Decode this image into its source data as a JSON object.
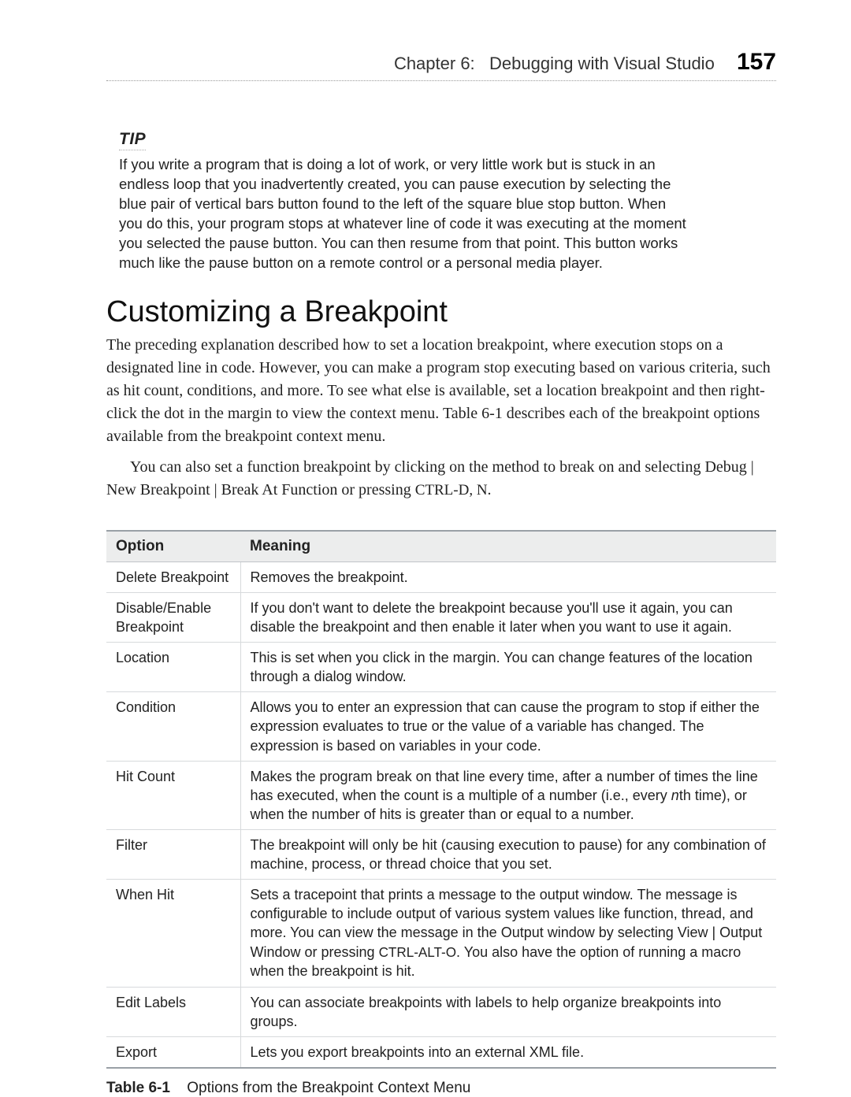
{
  "header": {
    "chapter_label": "Chapter 6:",
    "chapter_title": "Debugging with Visual Studio",
    "page_number": "157"
  },
  "tip": {
    "heading": "TIP",
    "body": "If you write a program that is doing a lot of work, or very little work but is stuck in an endless loop that you inadvertently created, you can pause execution by selecting the blue pair of vertical bars button found to the left of the square blue stop button. When you do this, your program stops at whatever line of code it was executing at the moment you selected the pause button. You can then resume from that point. This button works much like the pause button on a remote control or a personal media player."
  },
  "section": {
    "title": "Customizing a Breakpoint",
    "para1": "The preceding explanation described how to set a location breakpoint, where execution stops on a designated line in code. However, you can make a program stop executing based on various criteria, such as hit count, conditions, and more. To see what else is available, set a location breakpoint and then right-click the dot in the margin to view the context menu. Table 6-1 describes each of the breakpoint options available from the breakpoint context menu.",
    "para2_pre": "You can also set a function breakpoint by clicking on the method to break on and selecting Debug | New Breakpoint | Break At Function or pressing ",
    "para2_key": "CTRL-D, N",
    "para2_post": "."
  },
  "table": {
    "headers": {
      "option": "Option",
      "meaning": "Meaning"
    },
    "rows": [
      {
        "option": "Delete Breakpoint",
        "meaning_html": "Removes the breakpoint."
      },
      {
        "option": "Disable/Enable Breakpoint",
        "meaning_html": "If you don't want to delete the breakpoint because you'll use it again, you can disable the breakpoint and then enable it later when you want to use it again."
      },
      {
        "option": "Location",
        "meaning_html": "This is set when you click in the margin. You can change features of the location through a dialog window."
      },
      {
        "option": "Condition",
        "meaning_html": "Allows you to enter an expression that can cause the program to stop if either the expression evaluates to true or the value of a variable has changed. The expression is based on variables in your code."
      },
      {
        "option": "Hit Count",
        "meaning_html": "Makes the program break on that line every time, after a number of times the line has executed, when the count is a multiple of a number (i.e., every <span class=\"ital\">n</span>th time), or when the number of hits is greater than or equal to a number."
      },
      {
        "option": "Filter",
        "meaning_html": "The breakpoint will only be hit (causing execution to pause) for any combination of machine, process, or thread choice that you set."
      },
      {
        "option": "When Hit",
        "meaning_html": "Sets a tracepoint that prints a message to the output window. The message is configurable to include output of various system values like function, thread, and more. You can view the message in the Output window by selecting View | Output Window or pressing <span class=\"smallcaps\">CTRL-ALT-O</span>. You also have the option of running a macro when the breakpoint is hit."
      },
      {
        "option": "Edit Labels",
        "meaning_html": "You can associate breakpoints with labels to help organize breakpoints into groups."
      },
      {
        "option": "Export",
        "meaning_html": "Lets you export breakpoints into an external XML file."
      }
    ],
    "caption_label": "Table 6-1",
    "caption_text": "Options from the Breakpoint Context Menu"
  }
}
